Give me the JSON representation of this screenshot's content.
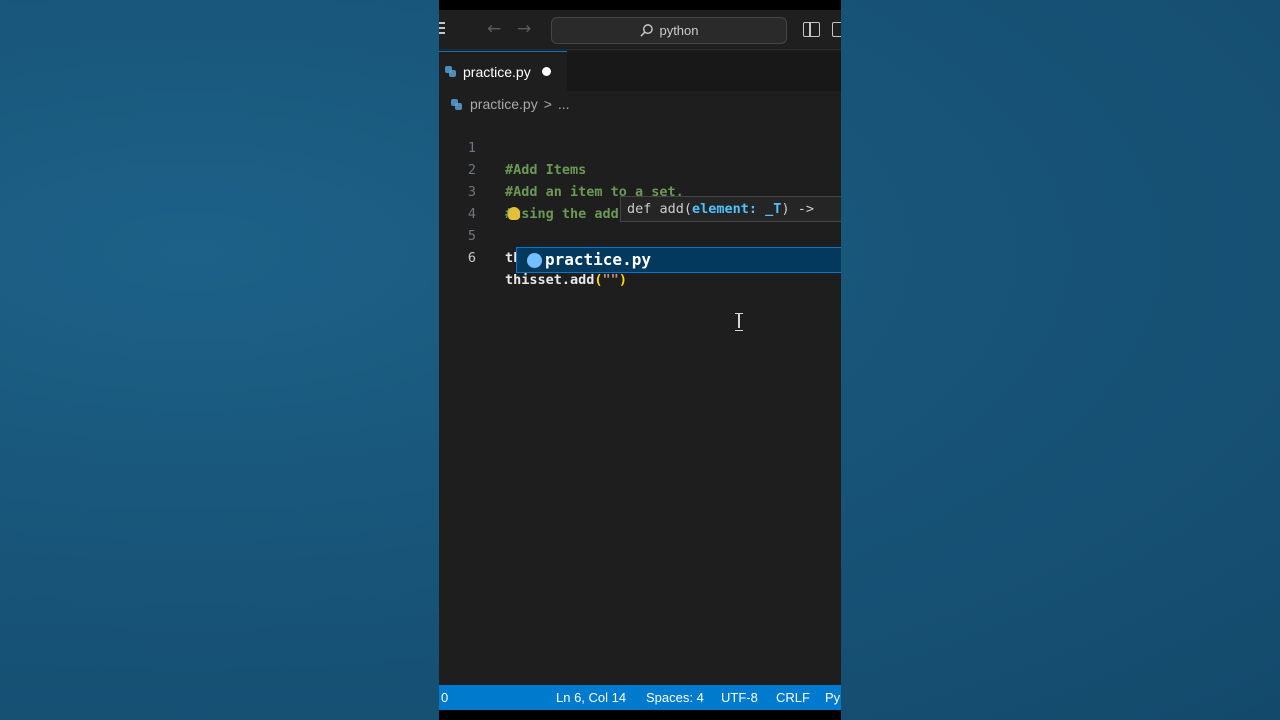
{
  "titlebar": {
    "search_text": "python"
  },
  "tab": {
    "label": "practice.py"
  },
  "breadcrumb": {
    "file": "practice.py",
    "separator": ">",
    "more": "..."
  },
  "editor": {
    "lines": [
      {
        "number": "1",
        "text": "#Add Items"
      },
      {
        "number": "2",
        "text": "#Add an item to a set,"
      },
      {
        "number": "3",
        "text": "#using the add() method:"
      },
      {
        "number": "4",
        "text": ""
      },
      {
        "number": "5",
        "var": "thisset",
        "op": " = ",
        "brace": "{",
        "str": "\"a"
      },
      {
        "number": "6",
        "var": "thisset.add",
        "paren_open": "(",
        "str": "\"\"",
        "paren_close": ")"
      }
    ],
    "active_line": "6"
  },
  "signature_hint": {
    "prefix": "def add(",
    "param": "element: _T",
    "suffix": ") ->"
  },
  "suggestion": {
    "label": "practice.py"
  },
  "statusbar": {
    "left": "0",
    "position": "Ln 6, Col 14",
    "spaces": "Spaces: 4",
    "encoding": "UTF-8",
    "eol": "CRLF",
    "language": "Py"
  },
  "colors": {
    "accent": "#007acc",
    "comment": "#6a9955",
    "editor_bg": "#1e1e1e"
  }
}
